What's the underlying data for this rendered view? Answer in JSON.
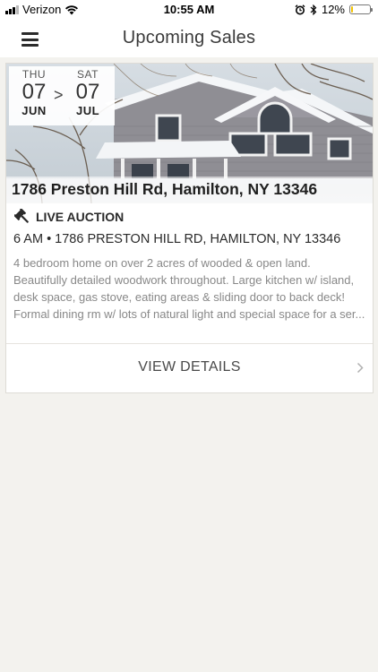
{
  "status_bar": {
    "carrier": "Verizon",
    "time": "10:55 AM",
    "battery": "12%",
    "battery_level": 0.12,
    "battery_color": "#f2c200"
  },
  "nav": {
    "menu_icon": "hamburger-menu-icon",
    "title": "Upcoming Sales"
  },
  "sale": {
    "start": {
      "dow": "THU",
      "day": "07",
      "month": "JUN"
    },
    "separator": ">",
    "end": {
      "dow": "SAT",
      "day": "07",
      "month": "JUL"
    },
    "address_title": "1786 Preston Hill Rd, Hamilton, NY 13346",
    "auction_icon": "gavel-icon",
    "auction_type": "LIVE AUCTION",
    "time_address": "6 AM • 1786 PRESTON HILL RD, HAMILTON, NY 13346",
    "description": "4 bedroom home on over 2 acres of wooded & open land. Beautifully detailed woodwork throughout. Large kitchen w/ island, desk space, gas stove, eating areas & sliding door to back deck! Formal dining rm w/ lots of natural light and special space for a ser...",
    "view_details_label": "VIEW DETAILS",
    "chevron_icon": "chevron-right-icon"
  }
}
